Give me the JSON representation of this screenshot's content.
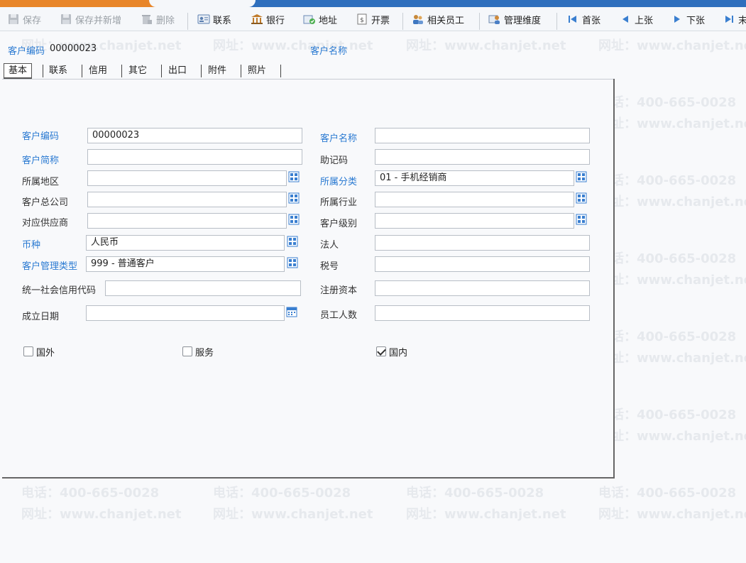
{
  "toolbar": {
    "save": "保存",
    "save_new": "保存并新增",
    "delete": "删除",
    "contact": "联系",
    "bank": "银行",
    "address": "地址",
    "invoice": "开票",
    "staff": "相关员工",
    "dimension": "管理维度",
    "first": "首张",
    "prev": "上张",
    "next": "下张",
    "last": "末"
  },
  "header": {
    "code_label": "客户编码",
    "code_value": "00000023",
    "name_label": "客户名称"
  },
  "tabs": [
    "基本",
    "联系",
    "信用",
    "其它",
    "出口",
    "附件",
    "照片"
  ],
  "form": {
    "cust_code": {
      "label": "客户编码",
      "value": "00000023"
    },
    "cust_name": {
      "label": "客户名称",
      "value": ""
    },
    "short_name": {
      "label": "客户简称",
      "value": ""
    },
    "mnemonic": {
      "label": "助记码",
      "value": ""
    },
    "region": {
      "label": "所属地区",
      "value": ""
    },
    "category": {
      "label": "所属分类",
      "value": "01 - 手机经销商"
    },
    "head_office": {
      "label": "客户总公司",
      "value": ""
    },
    "industry": {
      "label": "所属行业",
      "value": ""
    },
    "supplier": {
      "label": "对应供应商",
      "value": ""
    },
    "level": {
      "label": "客户级别",
      "value": ""
    },
    "currency": {
      "label": "币种",
      "value": "人民币"
    },
    "legal_person": {
      "label": "法人",
      "value": ""
    },
    "mgmt_type": {
      "label": "客户管理类型",
      "value": "999 - 普通客户"
    },
    "tax_no": {
      "label": "税号",
      "value": ""
    },
    "credit_code": {
      "label": "统一社会信用代码",
      "value": ""
    },
    "reg_capital": {
      "label": "注册资本",
      "value": ""
    },
    "est_date": {
      "label": "成立日期",
      "value": ""
    },
    "employees": {
      "label": "员工人数",
      "value": ""
    }
  },
  "checkboxes": {
    "foreign": {
      "label": "国外",
      "checked": false
    },
    "service": {
      "label": "服务",
      "checked": false
    },
    "domestic": {
      "label": "国内",
      "checked": true
    }
  },
  "watermark": {
    "phone": "电话：400-665-0028",
    "web": "网址：www.chanjet.net"
  },
  "colors": {
    "accent_blue": "#2a7ad2",
    "toolbar_bg": "#f5f7fa",
    "orange": "#e8862a"
  }
}
